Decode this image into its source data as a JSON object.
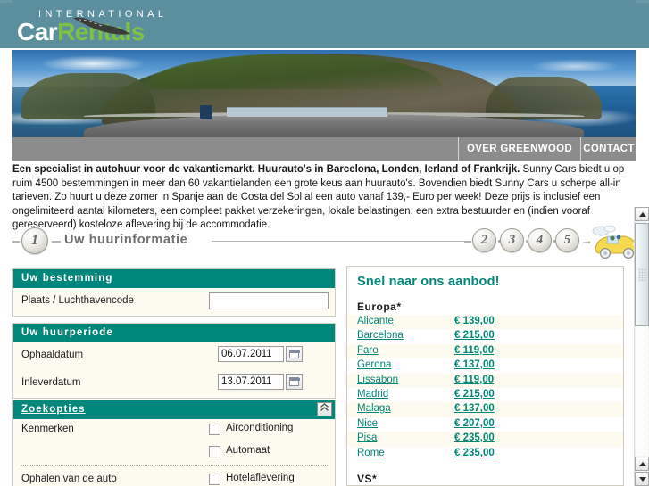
{
  "brand": {
    "international": "INTERNATIONAL",
    "name_part1": "Car",
    "name_part2": "Rentals",
    "header_bg": "#5c8f9d",
    "accent_green": "#7ec243",
    "accent_teal": "#00867a"
  },
  "nav": {
    "items": [
      {
        "label": "OVER GREENWOOD",
        "name": "nav-over-greenwood"
      },
      {
        "label": "CONTACT",
        "name": "nav-contact"
      }
    ]
  },
  "intro": {
    "lead": "Een specialist in autohuur voor de vakantiemarkt. Huurauto's in Barcelona, Londen, Ierland of Frankrijk.",
    "body": " Sunny Cars biedt u op ruim 4500 bestemmingen in meer dan 60 vakantielanden een grote keus aan huurauto's. Bovendien biedt Sunny Cars u scherpe all-in tarieven. Zo huurt u deze zomer in Spanje aan de Costa del Sol al een auto vanaf 139,- Euro per week! Deze prijs is inclusief een ongelimiteerd aantal kilometers, een compleet pakket verzekeringen, lokale belastingen, een extra bestuurder en (indien vooraf gereserveerd) kosteloze aflevering bij de accommodatie."
  },
  "steps": {
    "current_label": "Uw huurinformatie",
    "current_number": "1",
    "upcoming": [
      "2",
      "3",
      "4",
      "5"
    ],
    "arrow": "→",
    "car_icon": "convertible-car-icon"
  },
  "panels": {
    "destination": {
      "title": "Uw bestemming",
      "field_label": "Plaats / Luchthavencode",
      "field_value": "",
      "field_placeholder": ""
    },
    "period": {
      "title": "Uw huurperiode",
      "pickup_label": "Ophaaldatum",
      "pickup_value": "06.07.2011",
      "return_label": "Inleverdatum",
      "return_value": "13.07.2011",
      "calendar_icon": "calendar-icon"
    },
    "search_options": {
      "title": "Zoekopties",
      "collapse_icon": "chevron-double-up-icon",
      "features_label": "Kenmerken",
      "features": [
        {
          "label": "Airconditioning",
          "checked": false
        },
        {
          "label": "Automaat",
          "checked": false
        }
      ],
      "pickup_group_label": "Ophalen van de auto",
      "pickup_options": [
        {
          "label": "Hotelaflevering",
          "checked": false
        }
      ]
    }
  },
  "offers": {
    "title": "Snel naar ons aanbod!",
    "sections": [
      {
        "name": "Europa*",
        "rows": [
          {
            "city": "Alicante",
            "price": "€ 139,00"
          },
          {
            "city": "Barcelona",
            "price": "€ 215,00"
          },
          {
            "city": "Faro",
            "price": "€ 119,00"
          },
          {
            "city": "Gerona",
            "price": "€ 137,00"
          },
          {
            "city": "Lissabon",
            "price": "€ 119,00"
          },
          {
            "city": "Madrid",
            "price": "€ 215,00"
          },
          {
            "city": "Malaga",
            "price": "€ 137,00"
          },
          {
            "city": "Nice",
            "price": "€ 207,00"
          },
          {
            "city": "Pisa",
            "price": "€ 235,00"
          },
          {
            "city": "Rome",
            "price": "€ 235,00"
          }
        ]
      },
      {
        "name": "VS*",
        "rows": []
      }
    ]
  },
  "scrollbar": {
    "up_icon": "scroll-up-arrow-icon",
    "down_icon": "scroll-down-arrow-icon"
  }
}
